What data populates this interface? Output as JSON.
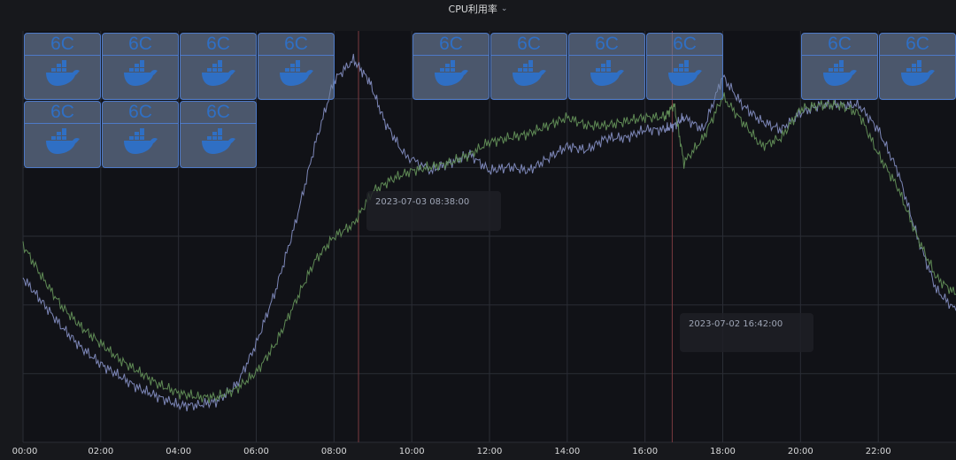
{
  "panel": {
    "title": "CPU利用率",
    "title_icon": "chevron-down-icon"
  },
  "tooltips": [
    {
      "text": "2023-07-03 08:38:00"
    },
    {
      "text": "2023-07-02 16:42:00"
    }
  ],
  "containers": {
    "label": "6C",
    "icon": "docker-whale-icon",
    "count": 13,
    "colors": {
      "fill": "#6f82a2",
      "border": "#4d79c7",
      "label": "#2f6fc4"
    }
  },
  "chart_data": {
    "type": "line",
    "x_tick_labels": [
      "00:00",
      "02:00",
      "04:00",
      "06:00",
      "08:00",
      "10:00",
      "12:00",
      "14:00",
      "16:00",
      "18:00",
      "20:00",
      "22:00"
    ],
    "x_unit": "hours",
    "xlim": [
      0,
      24
    ],
    "ylim": [
      0,
      100
    ],
    "grid": true,
    "annotation_lines_hours": [
      8.63,
      16.7
    ],
    "series": [
      {
        "color": "#7d87b8",
        "points": [
          [
            0,
            40
          ],
          [
            0.5,
            34
          ],
          [
            1,
            28
          ],
          [
            1.5,
            23
          ],
          [
            2,
            19
          ],
          [
            2.5,
            16
          ],
          [
            3,
            13
          ],
          [
            3.5,
            11
          ],
          [
            4,
            9
          ],
          [
            4.5,
            9
          ],
          [
            5,
            10
          ],
          [
            5.5,
            14
          ],
          [
            6,
            24
          ],
          [
            6.5,
            37
          ],
          [
            7,
            53
          ],
          [
            7.5,
            72
          ],
          [
            8,
            88
          ],
          [
            8.5,
            93
          ],
          [
            8.9,
            88
          ],
          [
            9.3,
            78
          ],
          [
            9.8,
            70
          ],
          [
            10.5,
            66
          ],
          [
            11,
            68
          ],
          [
            11.5,
            70
          ],
          [
            12,
            66
          ],
          [
            12.5,
            67
          ],
          [
            13,
            66
          ],
          [
            13.5,
            69
          ],
          [
            14,
            72
          ],
          [
            14.5,
            71
          ],
          [
            15,
            74
          ],
          [
            15.5,
            74
          ],
          [
            16,
            76
          ],
          [
            16.5,
            76
          ],
          [
            16.75,
            77
          ],
          [
            17,
            79
          ],
          [
            17.5,
            76
          ],
          [
            18,
            89
          ],
          [
            18.5,
            82
          ],
          [
            19,
            78
          ],
          [
            19.5,
            76
          ],
          [
            20,
            80
          ],
          [
            20.5,
            82
          ],
          [
            21,
            82
          ],
          [
            21.5,
            82
          ],
          [
            22,
            76
          ],
          [
            22.5,
            66
          ],
          [
            23,
            50
          ],
          [
            23.5,
            37
          ],
          [
            24,
            32
          ]
        ]
      },
      {
        "color": "#5f8a55",
        "points": [
          [
            0,
            48
          ],
          [
            0.5,
            40
          ],
          [
            1,
            33
          ],
          [
            1.5,
            28
          ],
          [
            2,
            24
          ],
          [
            2.5,
            20
          ],
          [
            3,
            17
          ],
          [
            3.5,
            14
          ],
          [
            4,
            12
          ],
          [
            4.5,
            11
          ],
          [
            5,
            11
          ],
          [
            5.5,
            13
          ],
          [
            6,
            17
          ],
          [
            6.5,
            24
          ],
          [
            7,
            34
          ],
          [
            7.5,
            44
          ],
          [
            8,
            50
          ],
          [
            8.5,
            53
          ],
          [
            9,
            61
          ],
          [
            9.5,
            64
          ],
          [
            10,
            66
          ],
          [
            10.5,
            67
          ],
          [
            11,
            68
          ],
          [
            11.5,
            70
          ],
          [
            12,
            73
          ],
          [
            12.5,
            74
          ],
          [
            13,
            75
          ],
          [
            13.5,
            77
          ],
          [
            14,
            79
          ],
          [
            14.5,
            77
          ],
          [
            15,
            77
          ],
          [
            15.5,
            78
          ],
          [
            16,
            79
          ],
          [
            16.5,
            79
          ],
          [
            16.75,
            82
          ],
          [
            17,
            68
          ],
          [
            17.5,
            74
          ],
          [
            18,
            84
          ],
          [
            18.5,
            78
          ],
          [
            19,
            72
          ],
          [
            19.5,
            74
          ],
          [
            20,
            81
          ],
          [
            20.5,
            82
          ],
          [
            21,
            82
          ],
          [
            21.5,
            80
          ],
          [
            22,
            70
          ],
          [
            22.5,
            62
          ],
          [
            23,
            50
          ],
          [
            23.5,
            40
          ],
          [
            24,
            36
          ]
        ]
      }
    ]
  }
}
